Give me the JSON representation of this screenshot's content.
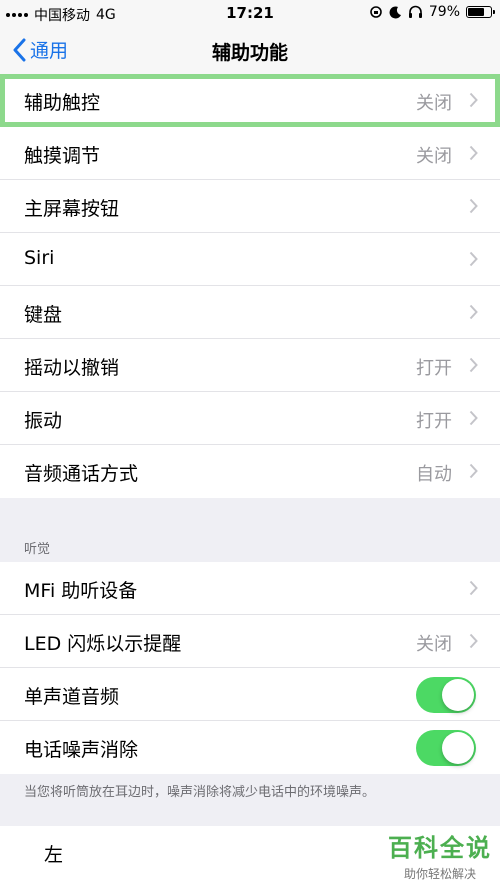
{
  "status_bar": {
    "carrier": "中国移动",
    "network": "4G",
    "time": "17:21",
    "battery": "79%",
    "battery_level": 0.79,
    "icons": [
      "lock-rotation-icon",
      "moon-icon",
      "headphones-icon",
      "battery-icon"
    ]
  },
  "nav": {
    "back_label": "通用",
    "title": "辅助功能"
  },
  "group1": [
    {
      "label": "辅助触控",
      "value": "关闭",
      "chevron": true
    },
    {
      "label": "触摸调节",
      "value": "关闭",
      "chevron": true
    },
    {
      "label": "主屏幕按钮",
      "value": "",
      "chevron": true
    },
    {
      "label": "Siri",
      "value": "",
      "chevron": true
    },
    {
      "label": "键盘",
      "value": "",
      "chevron": true
    },
    {
      "label": "摇动以撤销",
      "value": "打开",
      "chevron": true
    },
    {
      "label": "振动",
      "value": "打开",
      "chevron": true
    },
    {
      "label": "音频通话方式",
      "value": "自动",
      "chevron": true
    }
  ],
  "hearing": {
    "header": "听觉",
    "rows": [
      {
        "label": "MFi 助听设备",
        "value": "",
        "chevron": true
      },
      {
        "label": "LED 闪烁以示提醒",
        "value": "关闭",
        "chevron": true
      },
      {
        "label": "单声道音频",
        "toggle": true
      },
      {
        "label": "电话噪声消除",
        "toggle": true
      }
    ],
    "footnote": "当您将听筒放在耳边时，噪声消除将减少电话中的环境噪声。"
  },
  "bottom": {
    "label": "左"
  },
  "watermark": {
    "main": "百科全说",
    "sub": "助你轻松解决"
  },
  "colors": {
    "accent": "#1a73e8",
    "toggle_on": "#4cd964",
    "highlight": "#8dd98c"
  }
}
